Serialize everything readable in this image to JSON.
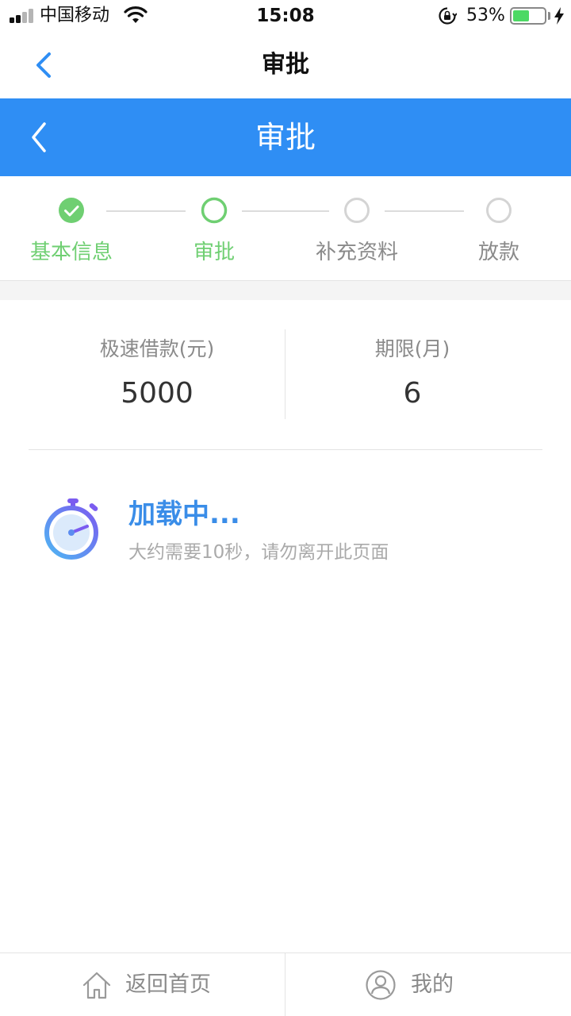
{
  "status_bar": {
    "carrier": "中国移动",
    "time": "15:08",
    "battery_percent_text": "53%",
    "battery_level": 0.53
  },
  "nav": {
    "title": "审批"
  },
  "header": {
    "title": "审批",
    "color": "#2f8ef4"
  },
  "steps": [
    {
      "label": "基本信息",
      "state": "done"
    },
    {
      "label": "审批",
      "state": "current"
    },
    {
      "label": "补充资料",
      "state": "pending"
    },
    {
      "label": "放款",
      "state": "pending"
    }
  ],
  "loan": {
    "amount_label": "极速借款(元)",
    "amount_value": "5000",
    "term_label": "期限(月)",
    "term_value": "6"
  },
  "loading": {
    "title": "加载中...",
    "description": "大约需要10秒，请勿离开此页面",
    "icon": "stopwatch-icon"
  },
  "tabbar": {
    "home_label": "返回首页",
    "home_icon": "home-icon",
    "mine_label": "我的",
    "mine_icon": "user-icon"
  },
  "colors": {
    "step_active": "#6fcf72",
    "step_pending": "#d4d4d4",
    "accent_blue": "#3a8de8"
  }
}
